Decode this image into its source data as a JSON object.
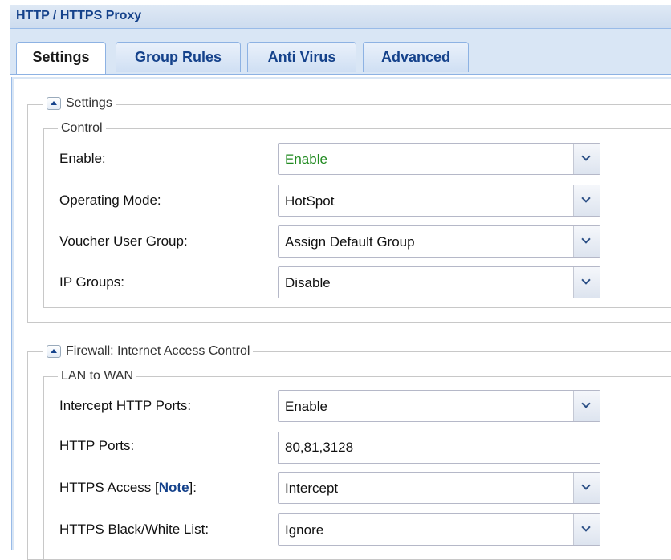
{
  "panel": {
    "title": "HTTP / HTTPS Proxy"
  },
  "tabs": [
    {
      "label": "Settings",
      "active": true
    },
    {
      "label": "Group Rules",
      "active": false
    },
    {
      "label": "Anti Virus",
      "active": false
    },
    {
      "label": "Advanced",
      "active": false
    }
  ],
  "settings_section": {
    "title": "Settings",
    "control_group": {
      "title": "Control",
      "rows": [
        {
          "label": "Enable:",
          "value": "Enable"
        },
        {
          "label": "Operating Mode:",
          "value": "HotSpot"
        },
        {
          "label": "Voucher User Group:",
          "value": "Assign Default Group"
        },
        {
          "label": "IP Groups:",
          "value": "Disable"
        }
      ]
    }
  },
  "firewall_section": {
    "title": "Firewall: Internet Access Control",
    "lan_group": {
      "title": "LAN to WAN",
      "intercept_http_ports": {
        "label": "Intercept HTTP Ports:",
        "value": "Enable"
      },
      "http_ports": {
        "label": "HTTP Ports:",
        "value": "80,81,3128"
      },
      "https_access": {
        "label_prefix": "HTTPS Access [",
        "note_link": "Note",
        "label_suffix": "]:",
        "value": "Intercept"
      },
      "https_list": {
        "label": "HTTPS Black/White List:",
        "value": "Ignore"
      }
    }
  },
  "colors": {
    "header_text": "#15428b",
    "enable_value": "#228b22",
    "tab_border": "#8db2e3"
  }
}
